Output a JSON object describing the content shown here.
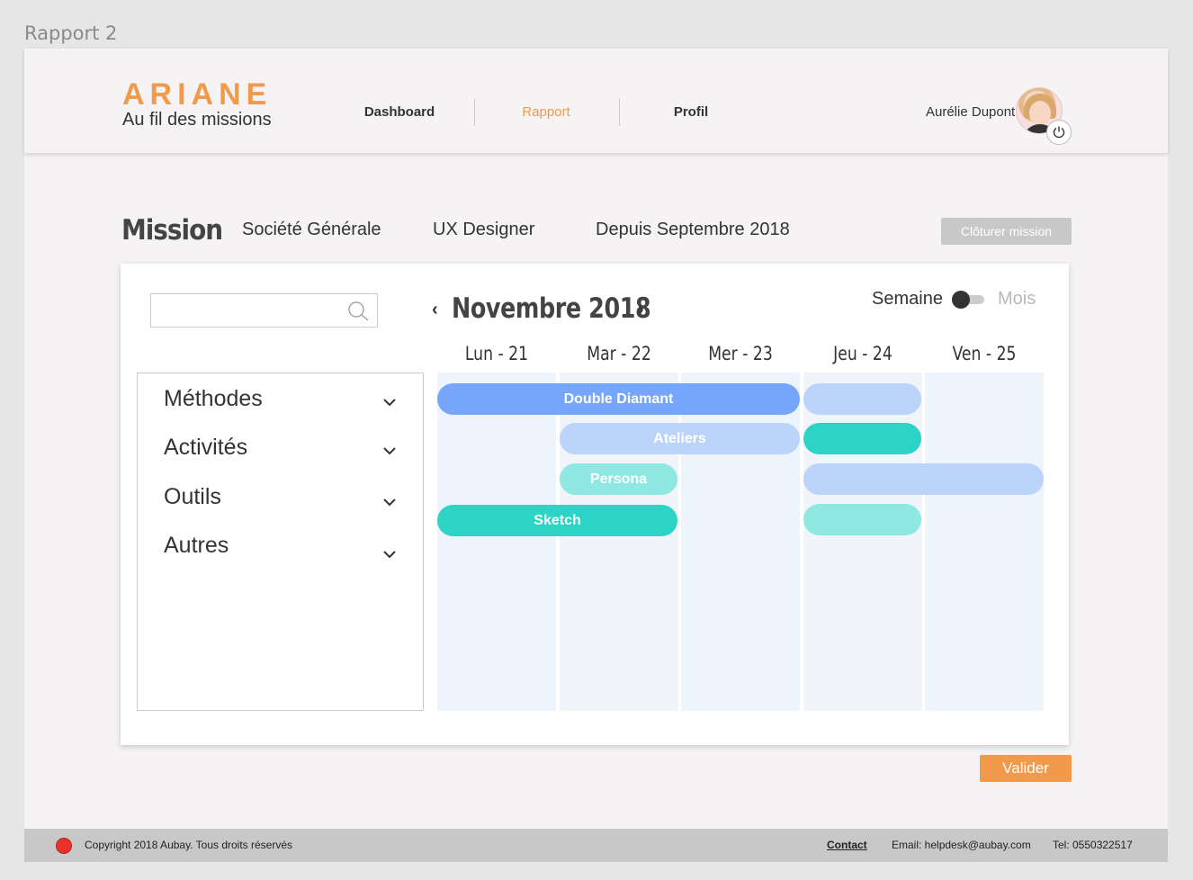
{
  "frame_label": "Rapport 2",
  "header": {
    "logo_title": "ARIANE",
    "logo_subtitle": "Au fil des missions",
    "nav": [
      {
        "label": "Dashboard",
        "active": false
      },
      {
        "label": "Rapport",
        "active": true
      },
      {
        "label": "Profil",
        "active": false
      }
    ],
    "user_name": "Aurélie Dupont",
    "avatar_icon": "user-avatar",
    "power_icon": "power-icon"
  },
  "mission": {
    "title": "Mission",
    "company": "Société Générale",
    "role": "UX Designer",
    "since": "Depuis Septembre 2018",
    "close_label": "Clôturer mission"
  },
  "calendar": {
    "search_placeholder": "",
    "month_label": "Novembre 2018",
    "prev_symbol": "‹",
    "next_symbol": "›",
    "view_week": "Semaine",
    "view_month": "Mois",
    "categories": [
      "Méthodes",
      "Activités",
      "Outils",
      "Autres"
    ],
    "days": [
      "Lun - 21",
      "Mar - 22",
      "Mer - 23",
      "Jeu - 24",
      "Ven - 25"
    ],
    "events": [
      {
        "label": "Double Diamant",
        "color": "#76a6f9"
      },
      {
        "label": "",
        "color": "#bcd3fa"
      },
      {
        "label": "Ateliers",
        "color": "#bcd3fa"
      },
      {
        "label": "",
        "color": "#2cd4c6"
      },
      {
        "label": "Persona",
        "color": "#8fe8e1"
      },
      {
        "label": "",
        "color": "#bcd3fa"
      },
      {
        "label": "Sketch",
        "color": "#2cd4c6"
      },
      {
        "label": "",
        "color": "#8fe8e1"
      }
    ]
  },
  "validate_label": "Valider",
  "footer": {
    "copyright": "Copyright 2018 Aubay. Tous droits réservés",
    "contact": "Contact",
    "email": "Email: helpdesk@aubay.com",
    "tel": "Tel: 0550322517"
  },
  "colors": {
    "accent": "#f29a4c",
    "blue": "#76a6f9",
    "light_blue": "#bcd3fa",
    "teal": "#2cd4c6",
    "light_teal": "#8fe8e1"
  }
}
